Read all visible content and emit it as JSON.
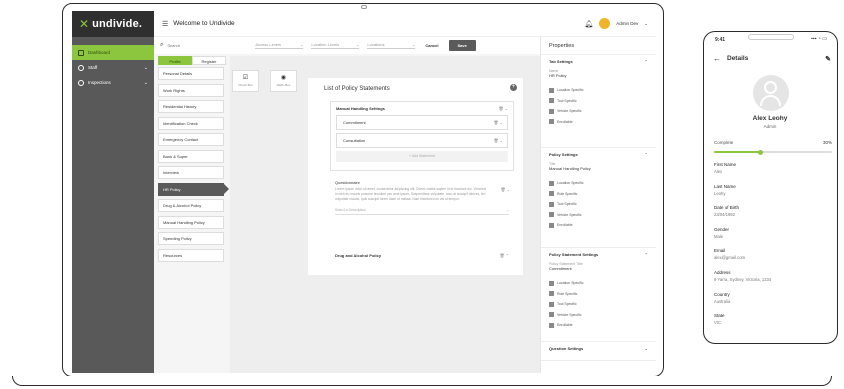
{
  "app": {
    "logo": "undivide.",
    "welcome": "Welcome to Undivide",
    "user": "Admin Dev",
    "chevron": "⌄"
  },
  "sidebar": {
    "items": [
      {
        "label": "Dashboard",
        "active": true
      },
      {
        "label": "Staff",
        "chev": "⌄"
      },
      {
        "label": "Inspections",
        "chev": "⌄"
      }
    ]
  },
  "filters": {
    "search_placeholder": "Search",
    "dropdowns": [
      "Access Levels",
      "Location Levels",
      "Locations"
    ],
    "cancel": "Cancel",
    "save": "Save"
  },
  "tabs": [
    "Profile",
    "Register"
  ],
  "policies": [
    "Personal Details",
    "Work Rights",
    "Residential History",
    "Identification Check",
    "Emergency Contact",
    "Bank & Super",
    "Interview",
    "HR Policy",
    "Drug & Alcohol Policy",
    "Manual Handling Policy",
    "Speeding Policy",
    "Resources"
  ],
  "tools": [
    {
      "icon": "☑",
      "label": "Check Box"
    },
    {
      "icon": "◉",
      "label": "Radio Box"
    }
  ],
  "card": {
    "title": "List of Policy Statements",
    "section1": {
      "title": "Manual Handling Settings",
      "rows": [
        "Commitment",
        "Consultation"
      ],
      "add": "+ Add Statement",
      "acts": "🗑 ⌄"
    },
    "question": {
      "title": "Questionnaire",
      "text": "Lorem ipsum dolor sit amet, consectetur adipiscing elit. Donec mattis sapien id et tincidunt dui. Vivamus in nibh eu mauris posuere tincidunt per urna ipsum. Suspendisse vulputate, arcu at suscipit ultrices, leo vulputate mauris, quis suscipit lorem diam ut massa. Nam tincidunt non vel ut tempor.",
      "select_placeholder": "Select a Description",
      "acts": "🗑 ⌄"
    },
    "section2": {
      "title": "Drug and Alcohol Policy",
      "acts": "🗑 ⌃"
    }
  },
  "properties": {
    "title": "Properties",
    "groups": [
      {
        "title": "Tab Settings",
        "label": "Name",
        "value": "HR Policy",
        "checks": [
          "Location Specific",
          "Tool Specific",
          "Vehicle Specific",
          "Enrollable"
        ]
      },
      {
        "title": "Policy Settings",
        "label": "Title",
        "value": "Manual Handling Policy",
        "checks": [
          "Location Specific",
          "Role Specific",
          "Tool Specific",
          "Vehicle Specific",
          "Enrollable"
        ]
      },
      {
        "title": "Policy Statement Settings",
        "label": "Policy Statement Title",
        "value": "Commitment",
        "checks": [
          "Location Specific",
          "Role Specific",
          "Tool Specific",
          "Vehicle Specific",
          "Enrollable"
        ]
      }
    ],
    "question_settings": "Question Settings"
  },
  "phone": {
    "time": "9:41",
    "signal": "▪▪▪ ◔ ▭",
    "header": "Details",
    "name": "Alex Leohy",
    "role": "Admin",
    "complete_label": "Complete",
    "complete_value": "30%",
    "complete_fraction": 0.4,
    "fields": [
      {
        "label": "First Name",
        "value": "Alex"
      },
      {
        "label": "Last Name",
        "value": "Leohy"
      },
      {
        "label": "Date of Birth",
        "value": "23/04/1992"
      },
      {
        "label": "Gender",
        "value": "Male"
      },
      {
        "label": "Email",
        "value": "alex@gmail.com"
      },
      {
        "label": "Address",
        "value": "9 Yarra, Sydney, Victoria, 1234"
      },
      {
        "label": "Country",
        "value": "Australia"
      },
      {
        "label": "State",
        "value": "VIC"
      }
    ]
  }
}
